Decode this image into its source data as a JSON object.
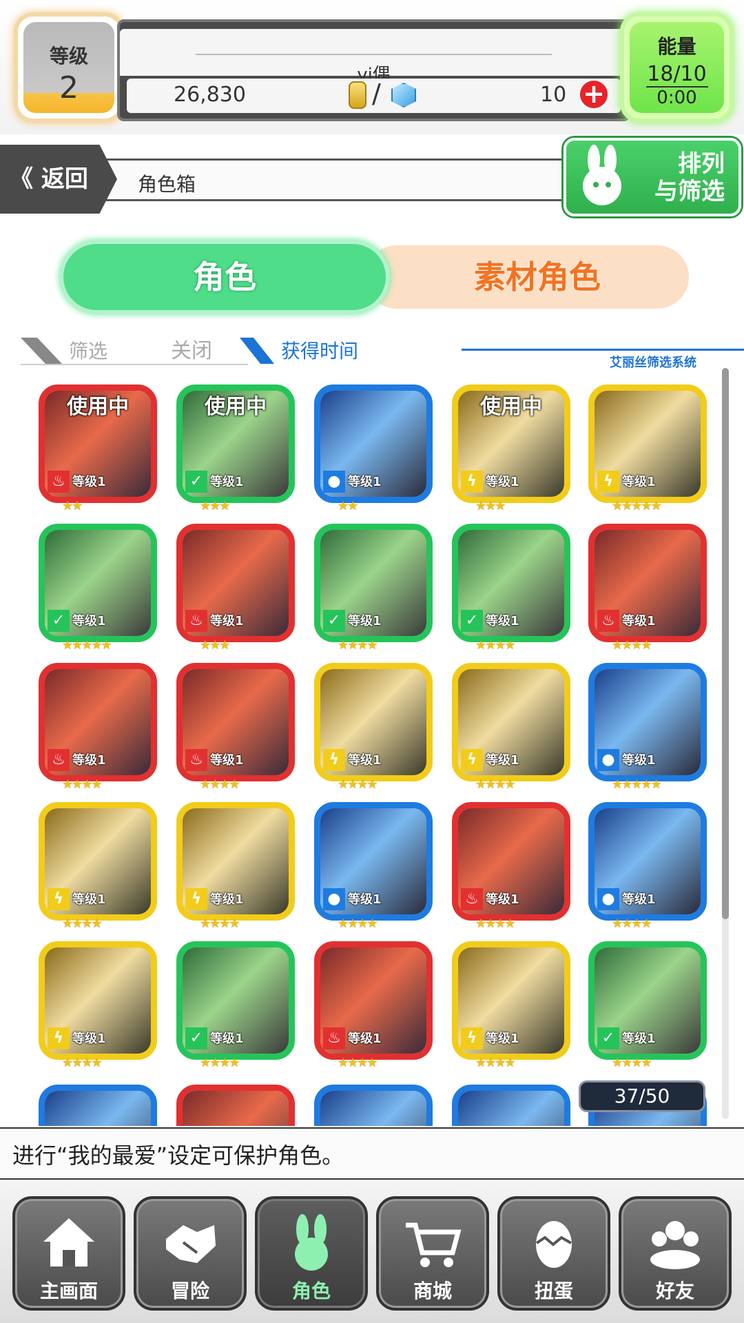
{
  "header": {
    "level_label": "等级",
    "level_value": "2",
    "player_name": "vj偶",
    "coins": "26,830",
    "separator": "/",
    "gems": "10",
    "plus": "+",
    "energy_label": "能量",
    "energy_value": "18/10",
    "energy_timer": "0:00"
  },
  "nav": {
    "back_label": "返回",
    "back_glyph": "《",
    "breadcrumb": "角色箱",
    "sort_filter_line1": "排列",
    "sort_filter_line2": "与筛选"
  },
  "tabs": {
    "characters": "角色",
    "materials": "素材角色"
  },
  "filter_bar": {
    "filter_label": "筛选",
    "filter_state": "关闭",
    "sort_label": "获得时间",
    "system_label": "艾丽丝筛选系统"
  },
  "element_colors": {
    "fire": "#e23030",
    "wind": "#25c45a",
    "water": "#1e7be0",
    "thunder": "#f2cc1a"
  },
  "element_icons": {
    "fire": "flame-icon",
    "wind": "leaf-icon",
    "water": "drop-icon",
    "thunder": "lightning-icon"
  },
  "in_use_label": "使用中",
  "level_prefix": "等级",
  "characters": [
    {
      "element": "fire",
      "level": "1",
      "stars": 2,
      "in_use": true
    },
    {
      "element": "wind",
      "level": "1",
      "stars": 3,
      "in_use": true
    },
    {
      "element": "water",
      "level": "1",
      "stars": 2,
      "in_use": false
    },
    {
      "element": "thunder",
      "level": "1",
      "stars": 3,
      "in_use": true
    },
    {
      "element": "thunder",
      "level": "1",
      "stars": 5,
      "in_use": false
    },
    {
      "element": "wind",
      "level": "1",
      "stars": 5,
      "in_use": false
    },
    {
      "element": "fire",
      "level": "1",
      "stars": 3,
      "in_use": false
    },
    {
      "element": "wind",
      "level": "1",
      "stars": 4,
      "in_use": false
    },
    {
      "element": "wind",
      "level": "1",
      "stars": 4,
      "in_use": false
    },
    {
      "element": "fire",
      "level": "1",
      "stars": 4,
      "in_use": false
    },
    {
      "element": "fire",
      "level": "1",
      "stars": 4,
      "in_use": false
    },
    {
      "element": "fire",
      "level": "1",
      "stars": 4,
      "in_use": false
    },
    {
      "element": "thunder",
      "level": "1",
      "stars": 4,
      "in_use": false
    },
    {
      "element": "thunder",
      "level": "1",
      "stars": 4,
      "in_use": false
    },
    {
      "element": "water",
      "level": "1",
      "stars": 5,
      "in_use": false
    },
    {
      "element": "thunder",
      "level": "1",
      "stars": 4,
      "in_use": false
    },
    {
      "element": "thunder",
      "level": "1",
      "stars": 4,
      "in_use": false
    },
    {
      "element": "water",
      "level": "1",
      "stars": 4,
      "in_use": false
    },
    {
      "element": "fire",
      "level": "1",
      "stars": 4,
      "in_use": false
    },
    {
      "element": "water",
      "level": "1",
      "stars": 4,
      "in_use": false
    },
    {
      "element": "thunder",
      "level": "1",
      "stars": 4,
      "in_use": false
    },
    {
      "element": "wind",
      "level": "1",
      "stars": 4,
      "in_use": false
    },
    {
      "element": "fire",
      "level": "1",
      "stars": 4,
      "in_use": false
    },
    {
      "element": "thunder",
      "level": "1",
      "stars": 4,
      "in_use": false
    },
    {
      "element": "wind",
      "level": "1",
      "stars": 4,
      "in_use": false
    }
  ],
  "partial_row_colors": [
    "water",
    "fire",
    "water",
    "water",
    "water"
  ],
  "count_badge": "37/50",
  "tip": "进行“我的最爱”设定可保护角色。",
  "bottom_nav": [
    {
      "label": "主画面",
      "icon": "home-icon"
    },
    {
      "label": "冒险",
      "icon": "handshake-icon"
    },
    {
      "label": "角色",
      "icon": "bunny-icon"
    },
    {
      "label": "商城",
      "icon": "cart-icon"
    },
    {
      "label": "扭蛋",
      "icon": "egg-icon"
    },
    {
      "label": "好友",
      "icon": "friends-icon"
    }
  ]
}
